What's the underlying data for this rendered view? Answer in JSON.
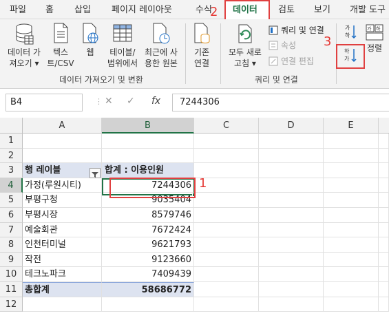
{
  "ribbon_tabs": [
    "파일",
    "홈",
    "삽입",
    "페이지 레이아웃",
    "수식",
    "데이터",
    "검토",
    "보기",
    "개발 도구"
  ],
  "active_tab": "데이터",
  "annotations": [
    "1",
    "2",
    "3"
  ],
  "ribbon": {
    "get_data": {
      "btn_get_data": [
        "데이터 가",
        "져오기 ▾"
      ],
      "btn_text_csv": [
        "텍스",
        "트/CSV"
      ],
      "btn_web": "웹",
      "btn_table_range": [
        "테이블/",
        "범위에서"
      ],
      "btn_recent_sources": [
        "최근에 사",
        "용한 원본"
      ],
      "group_label": "데이터 가져오기 및 변환"
    },
    "existing": {
      "btn_existing": [
        "기존",
        "연결"
      ]
    },
    "queries": {
      "btn_refresh_all": [
        "모두 새로",
        "고침 ▾"
      ],
      "item_queries_connections": "쿼리 및 연결",
      "item_properties": "속성",
      "item_edit_links": "연결 편집",
      "group_label": "쿼리 및 연결"
    },
    "sort": {
      "btn_sort": "정렬"
    }
  },
  "formula_bar": {
    "name_box": "B4",
    "fx": "fx",
    "formula_value": "7244306"
  },
  "sheet": {
    "columns": [
      "A",
      "B",
      "C",
      "D",
      "E"
    ],
    "rows": [
      "1",
      "2",
      "3",
      "4",
      "5",
      "6",
      "7",
      "8",
      "9",
      "10",
      "11",
      "12"
    ],
    "pivot_header": {
      "row_label": "행 레이블",
      "sum_label": "합계 : 이용인원"
    },
    "pivot_rows": [
      {
        "label": "가정(루원시티)",
        "value": "7244306"
      },
      {
        "label": "부평구청",
        "value": "9035404"
      },
      {
        "label": "부평시장",
        "value": "8579746"
      },
      {
        "label": "예술회관",
        "value": "7672424"
      },
      {
        "label": "인천터미널",
        "value": "9621793"
      },
      {
        "label": "작전",
        "value": "9123660"
      },
      {
        "label": "테크노파크",
        "value": "7409439"
      }
    ],
    "grand_total": {
      "label": "총합계",
      "value": "58686772"
    },
    "active_cell": "B4"
  }
}
